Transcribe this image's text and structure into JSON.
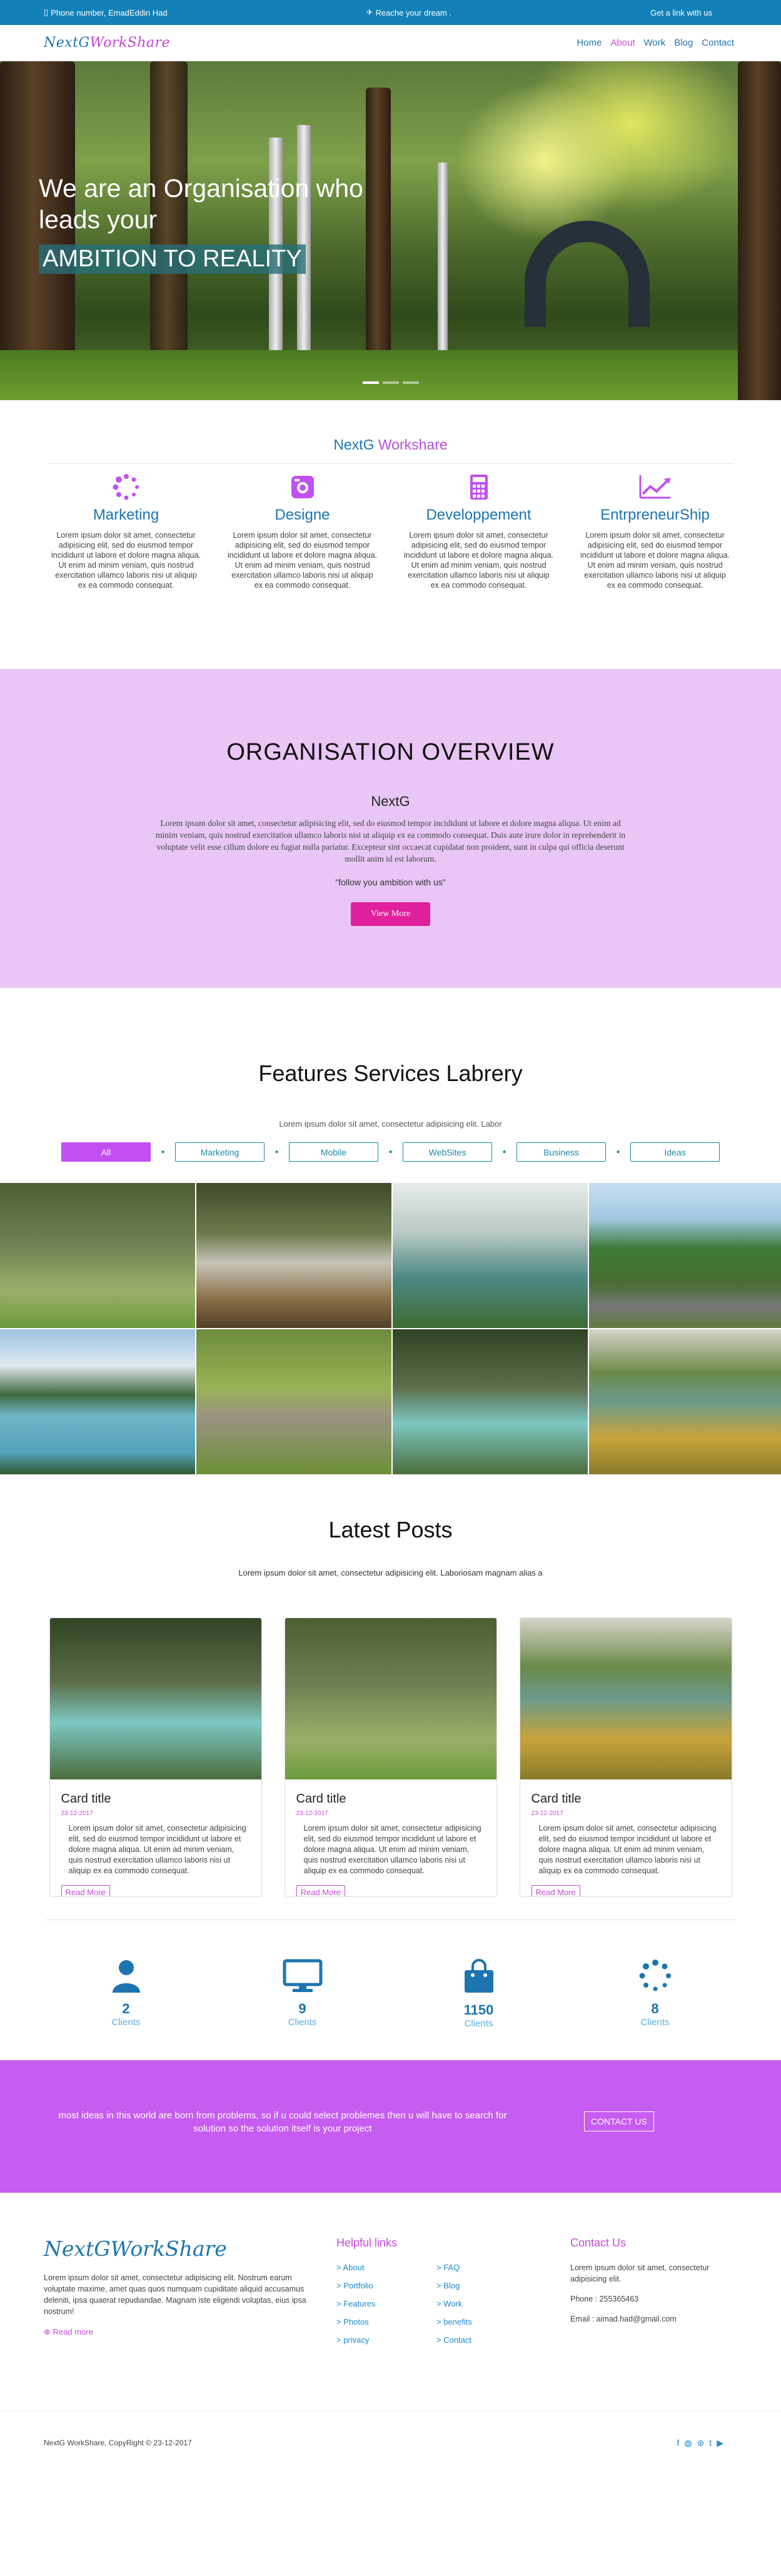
{
  "topbar": {
    "phone": "Phone number, EmadEddin Had",
    "dream": "Reache your dream .",
    "link": "Get a link with us"
  },
  "brand": {
    "part1": "NextG",
    "part2": "WorkShare"
  },
  "nav": [
    "Home",
    "About",
    "Work",
    "Blog",
    "Contact"
  ],
  "hero": {
    "line1": "We are an Organisation who",
    "line2": "leads your",
    "highlight": "AMBITION TO REALITY"
  },
  "workshare": {
    "title_a": "NextG",
    "title_b": "Workshare",
    "columns": [
      {
        "title": "Marketing",
        "icon": "spinner-icon",
        "text": "Lorem ipsum dolor sit amet, consectetur adipisicing elit, sed do eiusmod tempor incididunt ut labore et dolore magna aliqua. Ut enim ad minim veniam, quis nostrud exercitation ullamco laboris nisi ut aliquip ex ea commodo consequat."
      },
      {
        "title": "Designe",
        "icon": "camera-icon",
        "text": "Lorem ipsum dolor sit amet, consectetur adipisicing elit, sed do eiusmod tempor incididunt ut labore et dolore magna aliqua. Ut enim ad minim veniam, quis nostrud exercitation ullamco laboris nisi ut aliquip ex ea commodo consequat."
      },
      {
        "title": "Developpement",
        "icon": "calculator-icon",
        "text": "Lorem ipsum dolor sit amet, consectetur adipisicing elit, sed do eiusmod tempor incididunt ut labore et dolore magna aliqua. Ut enim ad minim veniam, quis nostrud exercitation ullamco laboris nisi ut aliquip ex ea commodo consequat."
      },
      {
        "title": "EntrpreneurShip",
        "icon": "chart-line-icon",
        "text": "Lorem ipsum dolor sit amet, consectetur adipisicing elit, sed do eiusmod tempor incididunt ut labore et dolore magna aliqua. Ut enim ad minim veniam, quis nostrud exercitation ullamco laboris nisi ut aliquip ex ea commodo consequat."
      }
    ]
  },
  "overview": {
    "title": "ORGANISATION OVERVIEW",
    "subtitle": "NextG",
    "text": "Lorem ipsum dolor sit amet, consectetur adipisicing elit, sed do eiusmod tempor incididunt ut labore et dolore magna aliqua. Ut enim ad minim veniam, quis nostrud exercitation ullamco laboris nisi ut aliquip ex ea commodo consequat. Duis aute irure dolor in reprehenderit in voluptate velit esse cillum dolore eu fugiat nulla pariatur. Excepteur sint occaecat cupidatat non proident, sunt in culpa qui officia deserunt mollit anim id est laborum.",
    "quote": "\"follow you ambition with us\"",
    "button": "View More"
  },
  "features": {
    "title": "Features Services Labrery",
    "sub": "Lorem ipsum dolor sit amet, consectetur adipisicing elit. Labor",
    "filters": [
      "All",
      "Marketing",
      "Mobile",
      "WebSites",
      "Business",
      "Ideas"
    ]
  },
  "posts": {
    "title": "Latest Posts",
    "sub": "Lorem ipsum dolor sit amet, consectetur adipisicing elit. Laboriosam magnam alias a",
    "cards": [
      {
        "title": "Card title",
        "date": "23-12-2017",
        "text": "Lorem ipsum dolor sit amet, consectetur adipisicing elit, sed do eiusmod tempor incididunt ut labore et dolore magna aliqua. Ut enim ad minim veniam, quis nostrud exercitation ullamco laboris nisi ut aliquip ex ea commodo consequat.",
        "button": "Read More"
      },
      {
        "title": "Card title",
        "date": "23-12-2017",
        "text": "Lorem ipsum dolor sit amet, consectetur adipisicing elit, sed do eiusmod tempor incididunt ut labore et dolore magna aliqua. Ut enim ad minim veniam, quis nostrud exercitation ullamco laboris nisi ut aliquip ex ea commodo consequat.",
        "button": "Read More"
      },
      {
        "title": "Card title",
        "date": "23-12-2017",
        "text": "Lorem ipsum dolor sit amet, consectetur adipisicing elit, sed do eiusmod tempor incididunt ut labore et dolore magna aliqua. Ut enim ad minim veniam, quis nostrud exercitation ullamco laboris nisi ut aliquip ex ea commodo consequat.",
        "button": "Read More"
      }
    ]
  },
  "stats": [
    {
      "icon": "user-icon",
      "value": "2",
      "label": "Clients"
    },
    {
      "icon": "monitor-icon",
      "value": "9",
      "label": "Clients"
    },
    {
      "icon": "shopping-bag-icon",
      "value": "1150",
      "label": "Clients"
    },
    {
      "icon": "spinner-icon",
      "value": "8",
      "label": "Clients"
    }
  ],
  "cta": {
    "text": "most ideas in this world are born from problems, so if u could select problemes then u will have to search for solution so the solution itself is your project",
    "button": "CONTACT US"
  },
  "footer": {
    "about": "Lorem ipsum dolor sit amet, consectetur adipisicing elit. Nostrum earum voluptate maxime, amet quas quos numquam cupiditate aliquid accusamus deleniti, ipsa quaerat repudiandae. Magnam iste eligendi voluptas, eius ipsa nostrum!",
    "read_more": "Read more",
    "helpful_title": "Helpful links",
    "links1": [
      "> About",
      "> Portfolio",
      "> Features",
      "> Photos",
      "> privacy"
    ],
    "links2": [
      "> FAQ",
      "> Blog",
      "> Work",
      "> benefits",
      "> Contact"
    ],
    "contact_title": "Contact Us",
    "contact_text": "Lorem ipsum dolor sit amet, consectetur adipisicing elit.",
    "phone": "Phone : 255365463",
    "email": "Email : aimad.had@gmail.com",
    "copyright": "NextG WorkShare, CopyRight © 23-12-2017"
  },
  "colors": {
    "blue": "#1d75b0",
    "topbar": "#1281b8",
    "purple": "#c44bd8",
    "overview_bg": "#e9c6f5",
    "cta_bg": "#c65cf0",
    "button_pink": "#e0209c"
  }
}
